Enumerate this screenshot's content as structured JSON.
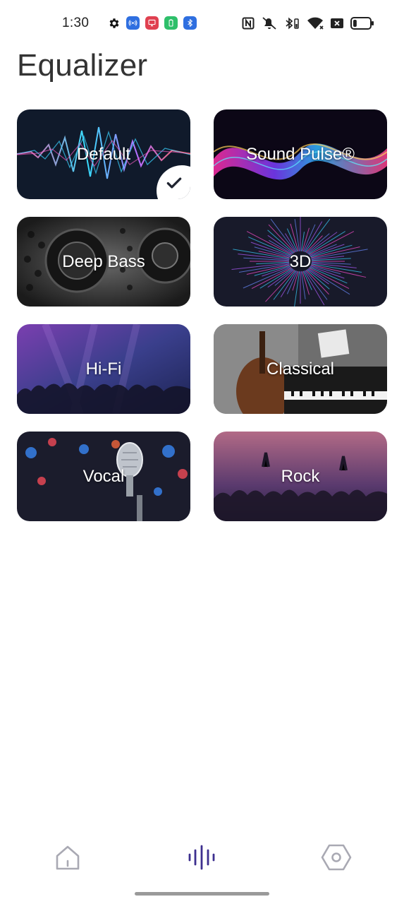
{
  "status_bar": {
    "time": "1:30",
    "left_icons": [
      {
        "name": "settings-icon",
        "color": "#111111"
      },
      {
        "name": "hotspot-icon",
        "color": "#2f6fe0"
      },
      {
        "name": "screen-record-icon",
        "color": "#e04050"
      },
      {
        "name": "battery-saver-icon",
        "color": "#2ebf6a"
      },
      {
        "name": "bluetooth-app-icon",
        "color": "#2f6fe0"
      }
    ],
    "right_icons": [
      "nfc-icon",
      "mute-icon",
      "bluetooth-battery-icon",
      "wifi-icon",
      "no-sim-icon",
      "battery-icon"
    ],
    "battery_level": 0.22
  },
  "title": "Equalizer",
  "presets": [
    {
      "label": "Default",
      "theme": "waves",
      "selected": true
    },
    {
      "label": "Sound Pulse®",
      "theme": "pulse",
      "selected": false
    },
    {
      "label": "Deep Bass",
      "theme": "speaker",
      "selected": false
    },
    {
      "label": "3D",
      "theme": "burst",
      "selected": false
    },
    {
      "label": "Hi-Fi",
      "theme": "crowd-purple",
      "selected": false
    },
    {
      "label": "Classical",
      "theme": "cello",
      "selected": false
    },
    {
      "label": "Vocal",
      "theme": "mic",
      "selected": false
    },
    {
      "label": "Rock",
      "theme": "crowd-red",
      "selected": false
    }
  ],
  "nav": {
    "items": [
      {
        "name": "home",
        "icon": "home-icon",
        "active": false
      },
      {
        "name": "equalizer",
        "icon": "equalizer-icon",
        "active": true
      },
      {
        "name": "settings",
        "icon": "settings-hex-icon",
        "active": false
      }
    ],
    "active_color": "#3d2f8f",
    "inactive_color": "#a9a9b3"
  }
}
